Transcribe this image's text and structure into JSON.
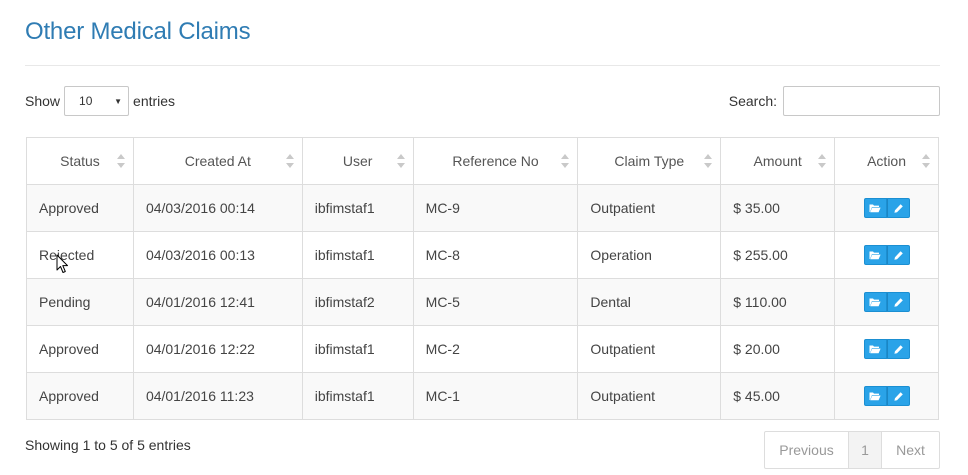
{
  "page": {
    "title": "Other Medical Claims"
  },
  "length_menu": {
    "show_label": "Show",
    "selected": "10",
    "entries_label": "entries"
  },
  "search": {
    "label": "Search:",
    "value": ""
  },
  "table": {
    "columns": [
      "Status",
      "Created At",
      "User",
      "Reference No",
      "Claim Type",
      "Amount",
      "Action"
    ],
    "rows": [
      {
        "status": "Approved",
        "created_at": "04/03/2016 00:14",
        "user": "ibfimstaf1",
        "reference_no": "MC-9",
        "claim_type": "Outpatient",
        "amount": "$ 35.00"
      },
      {
        "status": "Rejected",
        "created_at": "04/03/2016 00:13",
        "user": "ibfimstaf1",
        "reference_no": "MC-8",
        "claim_type": "Operation",
        "amount": "$ 255.00"
      },
      {
        "status": "Pending",
        "created_at": "04/01/2016 12:41",
        "user": "ibfimstaf2",
        "reference_no": "MC-5",
        "claim_type": "Dental",
        "amount": "$ 110.00"
      },
      {
        "status": "Approved",
        "created_at": "04/01/2016 12:22",
        "user": "ibfimstaf1",
        "reference_no": "MC-2",
        "claim_type": "Outpatient",
        "amount": "$ 20.00"
      },
      {
        "status": "Approved",
        "created_at": "04/01/2016 11:23",
        "user": "ibfimstaf1",
        "reference_no": "MC-1",
        "claim_type": "Outpatient",
        "amount": "$ 45.00"
      }
    ],
    "row_actions": [
      "folder-open-icon",
      "pencil-icon"
    ]
  },
  "info": {
    "text": "Showing 1 to 5 of 5 entries"
  },
  "pagination": {
    "previous": "Previous",
    "current_page": "1",
    "next": "Next"
  },
  "colors": {
    "title": "#2f7cb3",
    "action_button": "#2aa3e8",
    "stripe": "#f9f9f9",
    "border": "#dddddd"
  }
}
